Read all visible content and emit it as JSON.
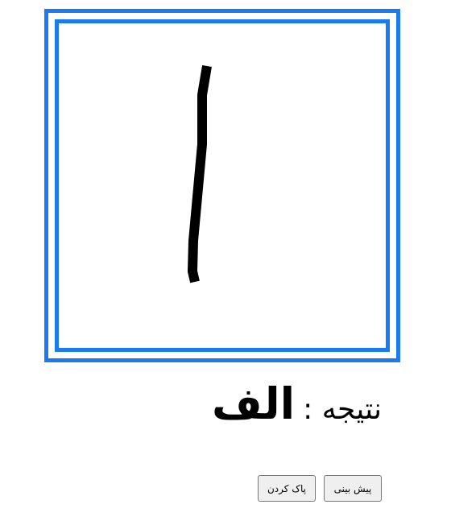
{
  "canvas": {
    "accent_color": "#1a7bf0",
    "stroke_color": "#000000",
    "drawing_content": "freehand stroke of the letter alef"
  },
  "result": {
    "label": "نتیجه :",
    "value": "الف"
  },
  "buttons": {
    "predict_label": "پیش بینی",
    "clear_label": "پاک کردن"
  }
}
